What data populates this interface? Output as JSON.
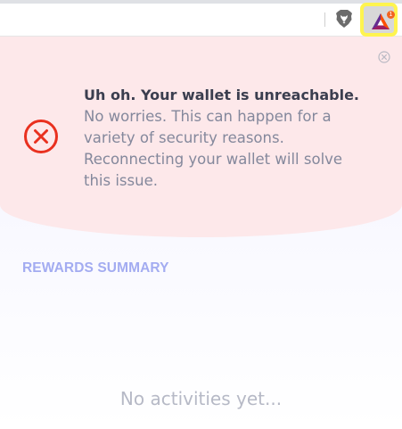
{
  "toolbar": {
    "shield_icon": "brave-lion-icon",
    "rewards_icon": "bat-triangle-icon",
    "rewards_badge": "1",
    "highlight_color": "#fff44f"
  },
  "alert": {
    "title": "Uh oh. Your wallet is unreachable.",
    "body": "No worries. This can happen for a variety of security reasons. Reconnecting your wallet will solve this issue.",
    "icon": "error-circle-icon",
    "accent_color": "#e9301f",
    "background_color": "#fde8ea"
  },
  "rewards": {
    "section_title": "REWARDS SUMMARY",
    "empty_message": "No activities yet..."
  }
}
